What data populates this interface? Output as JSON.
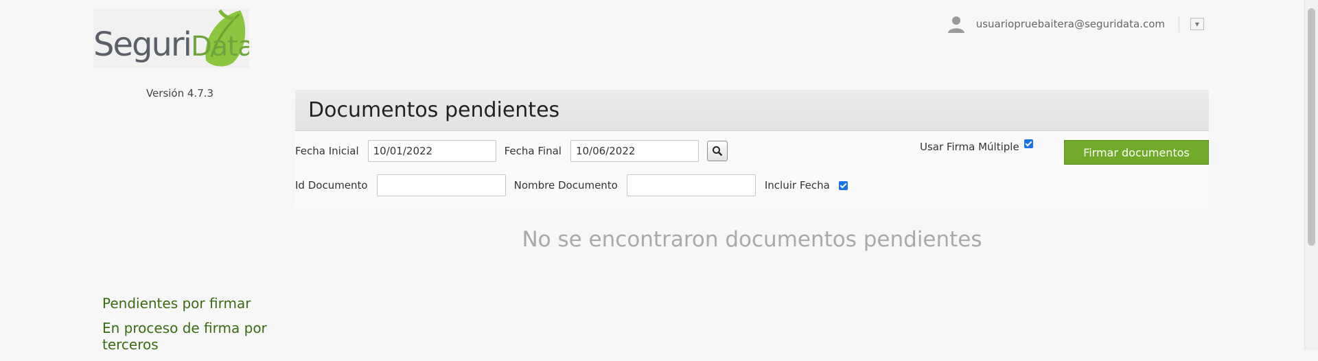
{
  "brand": {
    "logo_text_main": "Seguri",
    "logo_text_accent": "Data",
    "version": "Versión 4.7.3"
  },
  "header": {
    "user_email": "usuariopruebaitera@seguridata.com",
    "user_icon": "user-icon",
    "menu_icon": "caret-down-icon"
  },
  "panel": {
    "title": "Documentos pendientes",
    "fecha_inicial_label": "Fecha Inicial",
    "fecha_inicial_value": "10/01/2022",
    "fecha_final_label": "Fecha Final",
    "fecha_final_value": "10/06/2022",
    "search_icon": "search-icon",
    "usar_firma_label": "Usar Firma Múltiple",
    "usar_firma_checked": true,
    "firmar_button": "Firmar documentos",
    "id_documento_label": "Id Documento",
    "id_documento_value": "",
    "nombre_documento_label": "Nombre Documento",
    "nombre_documento_value": "",
    "incluir_fecha_label": "Incluir Fecha",
    "incluir_fecha_checked": true,
    "empty_message": "No se encontraron documentos pendientes"
  },
  "nav": {
    "items": [
      {
        "label": "Pendientes por firmar"
      },
      {
        "label": "En proceso de firma por terceros"
      }
    ]
  },
  "colors": {
    "accent_green": "#6fab28",
    "nav_green": "#3c6a12",
    "checkbox_blue": "#1a73e8"
  }
}
